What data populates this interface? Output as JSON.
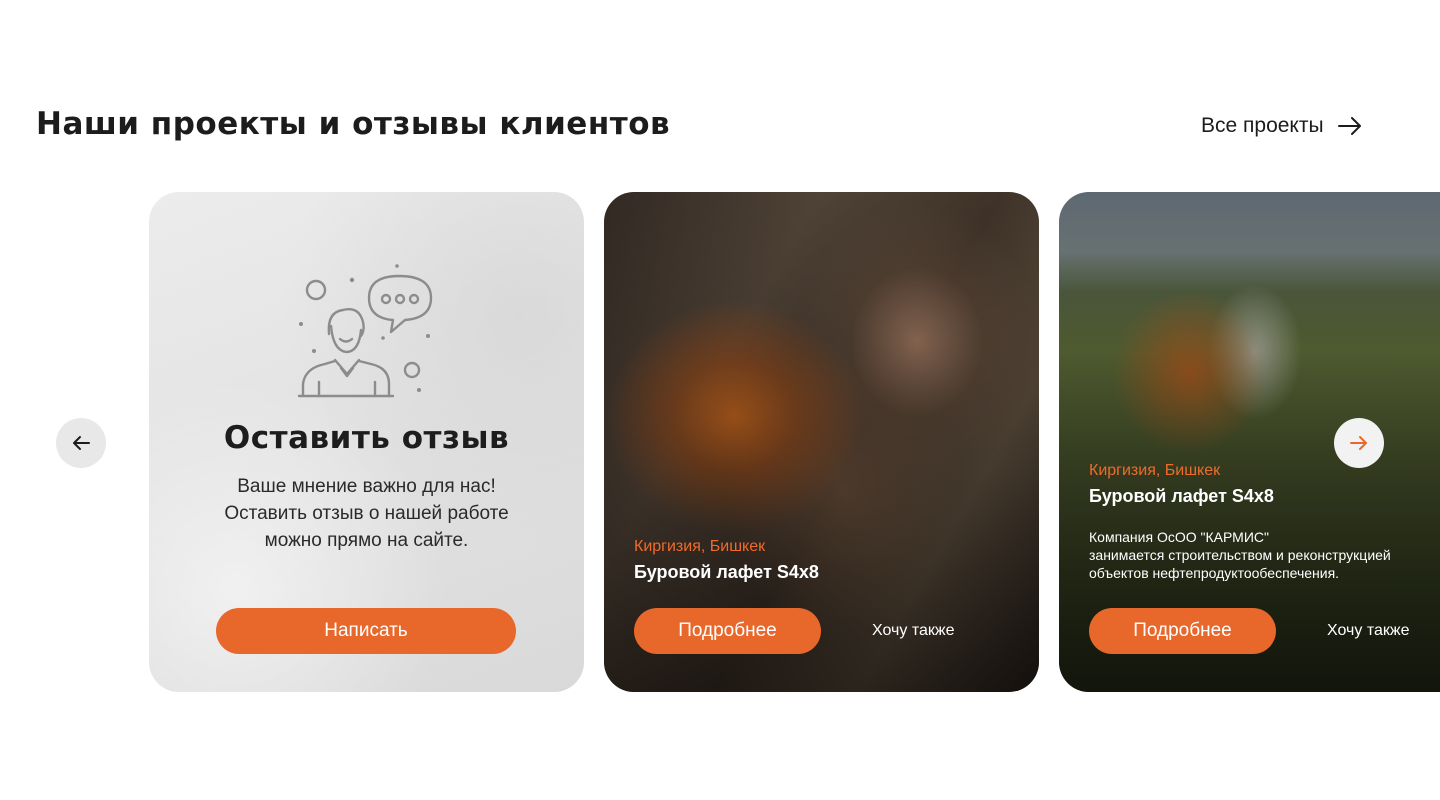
{
  "header": {
    "title": "Наши проекты и отзывы клиентов",
    "all_projects_label": "Все проекты"
  },
  "review_card": {
    "title": "Оставить отзыв",
    "text_lines": [
      "Ваше мнение важно для нас!",
      "Оставить отзыв о нашей работе",
      "можно прямо на сайте."
    ],
    "button_label": "Написать"
  },
  "projects": [
    {
      "region": "Киргизия, Бишкек",
      "name": "Буровой лафет S4x8",
      "more_label": "Подробнее",
      "want_label": "Хочу также"
    },
    {
      "region": "Киргизия, Бишкек",
      "name": "Буровой лафет S4x8",
      "description_lines": [
        "Компания ОсОО \"КАРМИС\"",
        "занимается строительством и реконструкцией",
        "объектов нефтепродуктообеспечения."
      ],
      "more_label": "Подробнее",
      "want_label": "Хочу также"
    }
  ],
  "icons": {
    "arrow_right": "arrow-right-icon",
    "prev": "arrow-left-icon",
    "next": "arrow-right-icon",
    "illustration": "person-chat-icon"
  },
  "colors": {
    "accent": "#e8672a",
    "accent_text": "#ef6b2c",
    "title": "#1c1c1c"
  }
}
